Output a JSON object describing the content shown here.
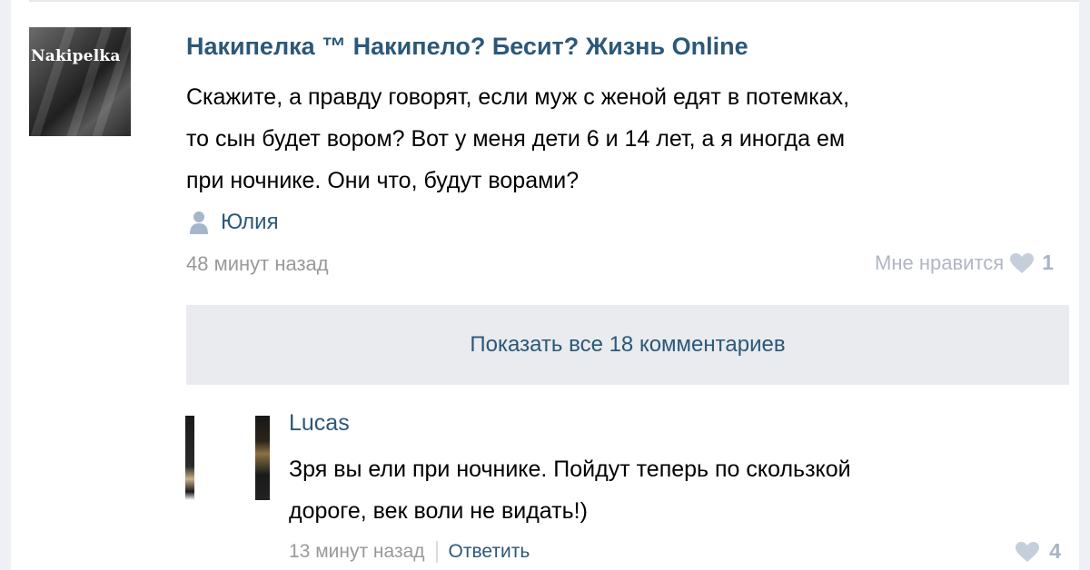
{
  "post": {
    "group_name": "Накипелка ™ Накипело? Бесит? Жизнь Online",
    "avatar_text": "Nakipelka",
    "body_lines": [
      "Скажите, а правду говорят, если муж с женой едят в потемках,",
      "то сын будет вором? Вот у меня дети 6 и 14 лет, а я иногда ем",
      "при ночнике. Они что, будут ворами?"
    ],
    "author": "Юлия",
    "author_icon": "person-icon",
    "time": "48 минут назад",
    "like_label": "Мне нравится",
    "like_icon": "heart-icon",
    "like_count": "1"
  },
  "show_all_comments": "Показать все 18 комментариев",
  "comment": {
    "author": "Lucas",
    "body_lines": [
      "Зря вы ели при ночнике. Пойдут теперь по скользкой",
      "дороге, век воли не видать!)"
    ],
    "time": "13 минут назад",
    "reply_label": "Ответить",
    "like_icon": "heart-icon",
    "like_count": "4"
  },
  "colors": {
    "link": "#2b587a",
    "muted": "#999999",
    "like": "#a7b4c6",
    "panel": "#e9ebee"
  }
}
